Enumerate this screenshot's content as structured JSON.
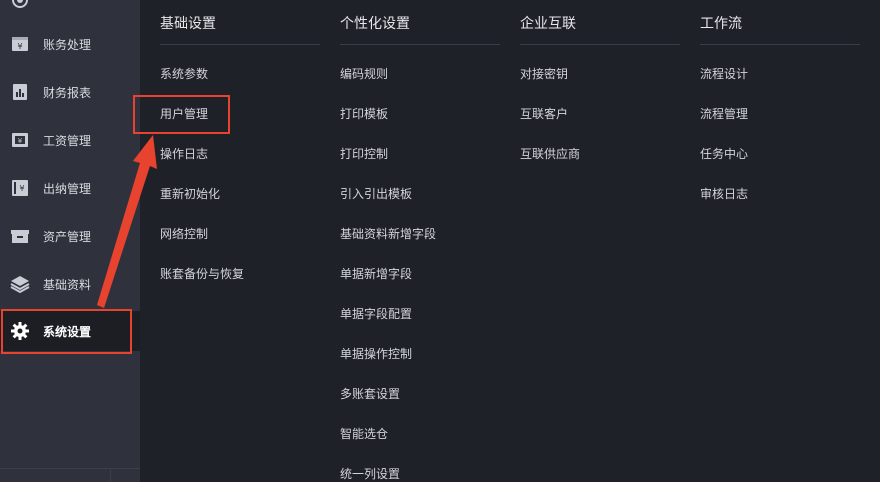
{
  "sidebar": {
    "items": [
      {
        "label": "账务处理",
        "icon": "ledger-icon",
        "active": false
      },
      {
        "label": "财务报表",
        "icon": "report-icon",
        "active": false
      },
      {
        "label": "工资管理",
        "icon": "wage-icon",
        "active": false
      },
      {
        "label": "出纳管理",
        "icon": "cashier-icon",
        "active": false
      },
      {
        "label": "资产管理",
        "icon": "asset-icon",
        "active": false
      },
      {
        "label": "基础资料",
        "icon": "layers-icon",
        "active": false
      },
      {
        "label": "系统设置",
        "icon": "gear-icon",
        "active": true
      }
    ]
  },
  "menu": {
    "columns": [
      {
        "title": "基础设置",
        "items": [
          "系统参数",
          "用户管理",
          "操作日志",
          "重新初始化",
          "网络控制",
          "账套备份与恢复"
        ]
      },
      {
        "title": "个性化设置",
        "items": [
          "编码规则",
          "打印模板",
          "打印控制",
          "引入引出模板",
          "基础资料新增字段",
          "单据新增字段",
          "单据字段配置",
          "单据操作控制",
          "多账套设置",
          "智能选仓",
          "统一列设置"
        ]
      },
      {
        "title": "企业互联",
        "items": [
          "对接密钥",
          "互联客户",
          "互联供应商"
        ]
      },
      {
        "title": "工作流",
        "items": [
          "流程设计",
          "流程管理",
          "任务中心",
          "审核日志"
        ]
      }
    ]
  },
  "colors": {
    "sidebar_bg": "#2f323d",
    "menu_bg": "#1f2128",
    "highlight": "#e8432f"
  }
}
